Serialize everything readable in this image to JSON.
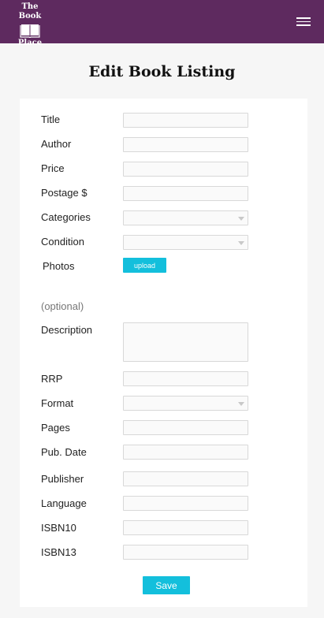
{
  "header": {
    "logo_line1": "The Book",
    "logo_line2": "Place",
    "logo_icon": "open-book-icon",
    "menu_icon": "hamburger-menu-icon",
    "background_color": "#5e2a5f"
  },
  "page": {
    "title": "Edit Book Listing"
  },
  "form": {
    "title_label": "Title",
    "author_label": "Author",
    "price_label": "Price",
    "postage_label": "Postage $",
    "categories_label": "Categories",
    "condition_label": "Condition",
    "photos_label": "Photos",
    "upload_label": "upload",
    "optional_label": "(optional)",
    "description_label": "Description",
    "rrp_label": "RRP",
    "format_label": "Format",
    "pages_label": "Pages",
    "pub_date_label": "Pub. Date",
    "publisher_label": "Publisher",
    "language_label": "Language",
    "isbn10_label": "ISBN10",
    "isbn13_label": "ISBN13",
    "save_label": "Save",
    "button_color": "#13bfdc"
  }
}
